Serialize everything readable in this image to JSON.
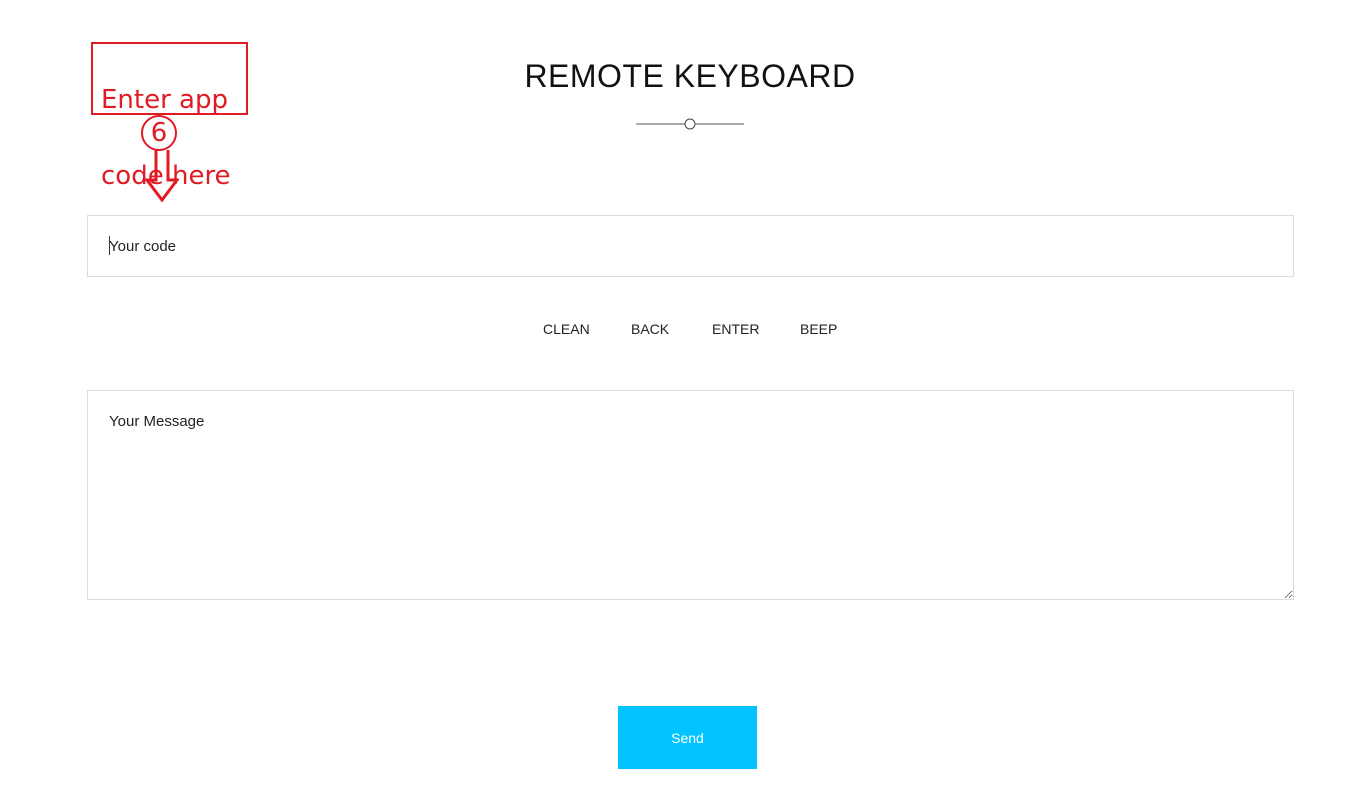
{
  "annotation": {
    "line1": "Enter app",
    "line2": "code here",
    "step": "6",
    "color": "#e01b24"
  },
  "header": {
    "title": "REMOTE KEYBOARD"
  },
  "code_field": {
    "placeholder": "Your code"
  },
  "actions": {
    "clean": "CLEAN",
    "back": "BACK",
    "enter": "ENTER",
    "beep": "BEEP"
  },
  "message_field": {
    "placeholder": "Your Message"
  },
  "send": {
    "label": "Send",
    "color": "#00c3ff"
  }
}
